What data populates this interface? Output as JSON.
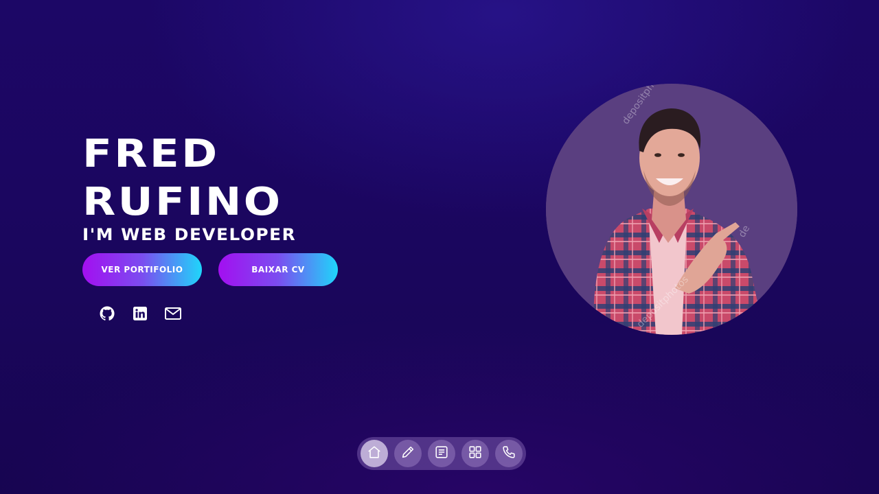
{
  "hero": {
    "name_line1": "FRED",
    "name_line2": "RUFINO",
    "role": "I'M WEB DEVELOPER",
    "portfolio_button": "VER PORTIFOLIO",
    "cv_button": "BAIXAR CV"
  },
  "social_links": [
    {
      "name": "github",
      "icon": "github-icon"
    },
    {
      "name": "linkedin",
      "icon": "linkedin-icon"
    },
    {
      "name": "email",
      "icon": "mail-icon"
    }
  ],
  "profile_photo": {
    "watermark_top": "depositphotos",
    "watermark_bottom": "depositphotos",
    "watermark_right": "de"
  },
  "dock": {
    "items": [
      {
        "name": "home",
        "icon": "home-icon",
        "active": true
      },
      {
        "name": "edit",
        "icon": "pencil-icon",
        "active": false
      },
      {
        "name": "document",
        "icon": "document-icon",
        "active": false
      },
      {
        "name": "apps",
        "icon": "grid-icon",
        "active": false
      },
      {
        "name": "contact",
        "icon": "phone-icon",
        "active": false
      }
    ]
  },
  "colors": {
    "background_top": "#1c0766",
    "background_bottom": "#170551",
    "button_gradient_start": "#a30ff0",
    "button_gradient_end": "#1fd6fa",
    "text": "#ffffff",
    "avatar_bg": "#5a3f80"
  }
}
